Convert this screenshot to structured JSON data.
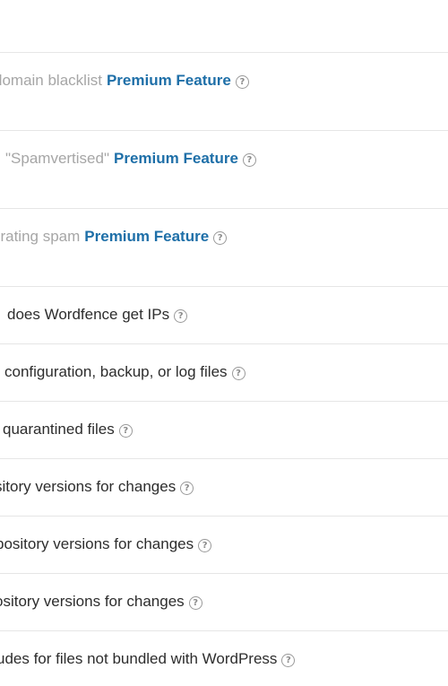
{
  "options": [
    {
      "label": "domain blacklist",
      "premium": "Premium Feature",
      "help_glyph": "?"
    },
    {
      "label": "\"Spamvertised\"",
      "premium": "Premium Feature",
      "help_glyph": "?"
    },
    {
      "label": "erating spam",
      "premium": "Premium Feature",
      "help_glyph": "?"
    },
    {
      "label": "does Wordfence get IPs",
      "help_glyph": "?"
    },
    {
      "label": "configuration, backup, or log files",
      "help_glyph": "?"
    },
    {
      "label": "quarantined files",
      "help_glyph": "?"
    },
    {
      "label": "sitory versions for changes",
      "help_glyph": "?"
    },
    {
      "label": "pository versions for changes",
      "help_glyph": "?"
    },
    {
      "label": "ository versions for changes",
      "help_glyph": "?"
    },
    {
      "label": "udes for files not bundled with WordPress",
      "help_glyph": "?"
    }
  ],
  "colors": {
    "premium": "#1e6fa8",
    "disabled_text": "#a6a6a6",
    "text": "#2d2d2d",
    "divider": "#e6e6e6"
  }
}
